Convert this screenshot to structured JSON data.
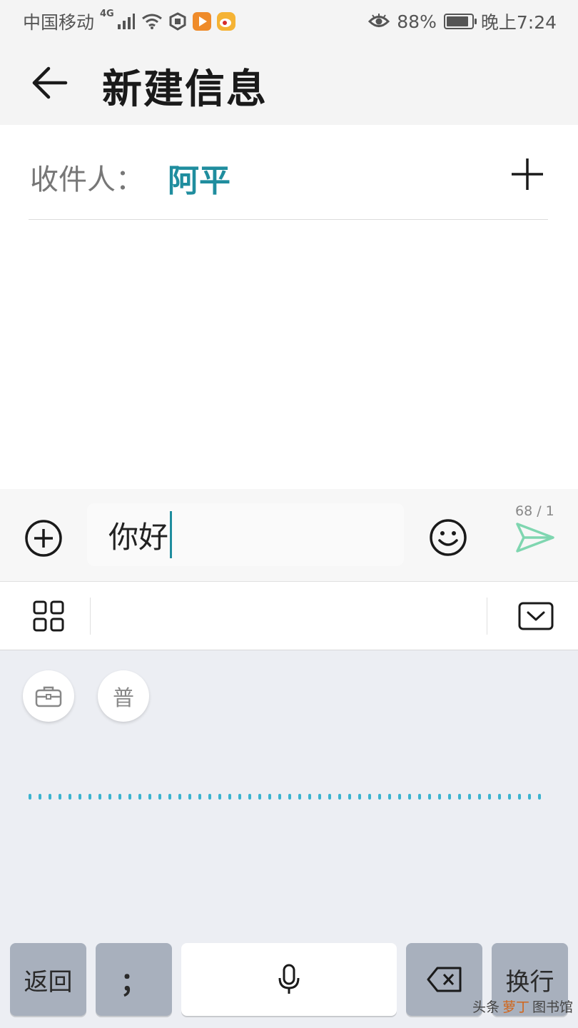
{
  "status_bar": {
    "carrier": "中国移动",
    "network": "4G",
    "battery_percent": "88%",
    "battery_level": 0.88,
    "time": "晚上7:24"
  },
  "header": {
    "title": "新建信息",
    "back_icon": "arrow-left-icon"
  },
  "recipient": {
    "label": "收件人：",
    "name": "阿平",
    "add_icon": "plus-icon"
  },
  "composer": {
    "text": "你好",
    "counter": "68 / 1",
    "attach_icon": "plus-circle-icon",
    "emoji_icon": "smiley-icon",
    "send_icon": "send-icon",
    "accent_color": "#1f8d9e",
    "send_color": "#7fd6b0"
  },
  "keyboard": {
    "toolbar_icons": [
      "grid-menu-icon",
      "keyboard-hide-icon"
    ],
    "toolbox_icon": "toolbox-icon",
    "mandarin_label": "普",
    "keys": {
      "return": "返回",
      "semicolon": "；",
      "delete_icon": "backspace-icon",
      "newline": "换行"
    },
    "mic_icon": "microphone-icon"
  },
  "watermark": {
    "prefix": "头条",
    "accent": "萝丁",
    "suffix": "图书馆"
  }
}
